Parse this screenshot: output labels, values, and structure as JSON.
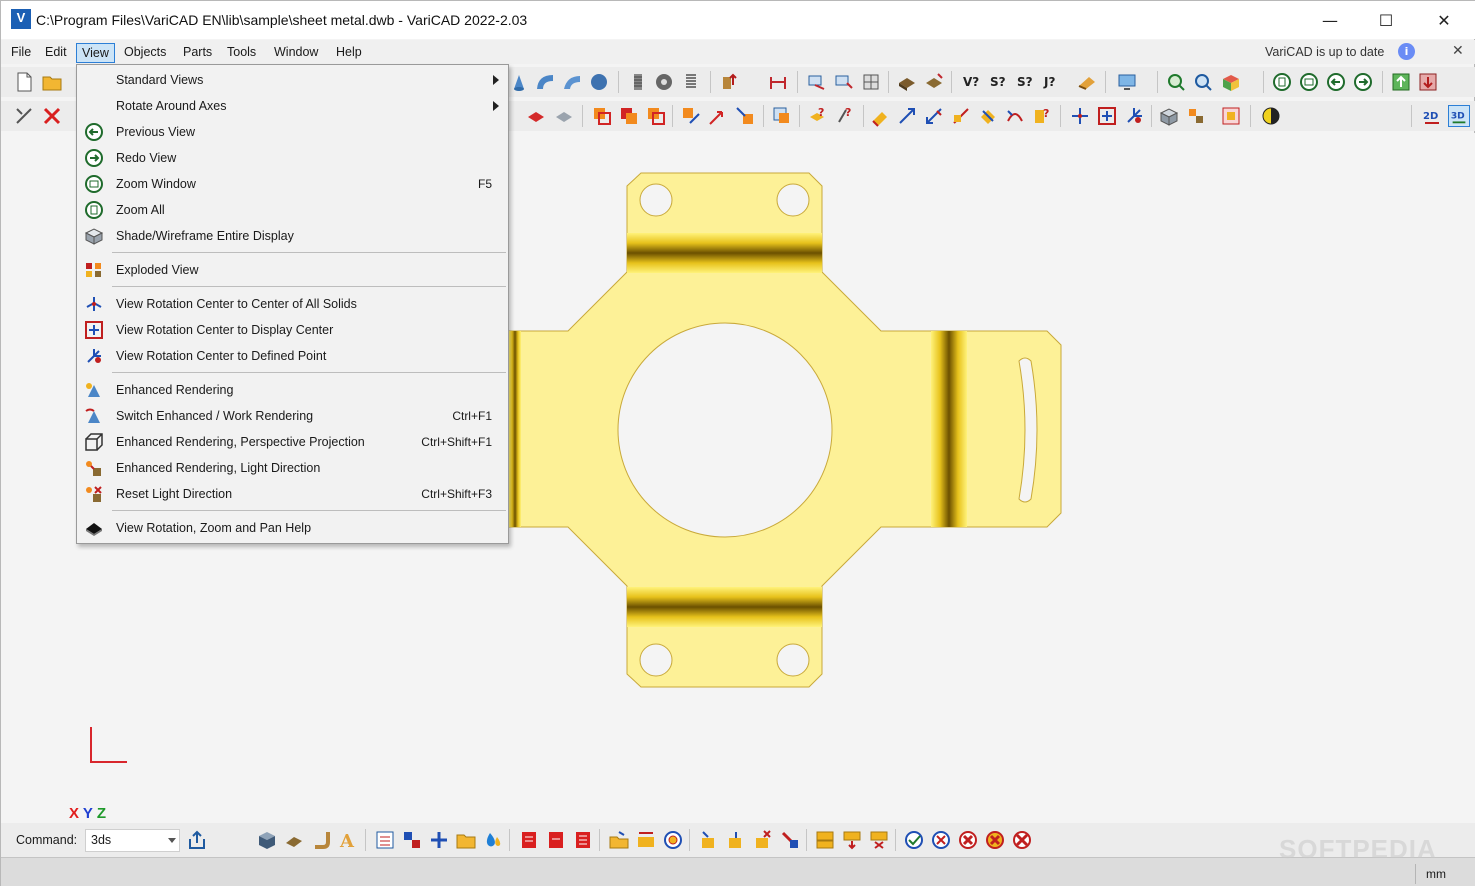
{
  "window": {
    "title": "C:\\Program Files\\VariCAD EN\\lib\\sample\\sheet metal.dwb - VariCAD 2022-2.03",
    "logo": "V",
    "minimize_glyph": "—",
    "maximize_glyph": "☐",
    "close_glyph": "✕"
  },
  "menubar": {
    "items": [
      "File",
      "Edit",
      "View",
      "Objects",
      "Parts",
      "Tools",
      "Window",
      "Help"
    ],
    "active": "View",
    "status_note": "VariCAD is up to date",
    "info_glyph": "i",
    "close_glyph": "✕"
  },
  "view_menu": {
    "items": [
      {
        "label": "Standard Views",
        "shortcut": "",
        "submenu": true,
        "icon": "none"
      },
      {
        "label": "Rotate Around Axes",
        "shortcut": "",
        "submenu": true,
        "icon": "none"
      },
      {
        "label": "Previous View",
        "shortcut": "",
        "icon": "previous-view-icon"
      },
      {
        "label": "Redo View",
        "shortcut": "",
        "icon": "redo-view-icon"
      },
      {
        "label": "Zoom Window",
        "shortcut": "F5",
        "icon": "zoom-window-icon"
      },
      {
        "label": "Zoom All",
        "shortcut": "",
        "icon": "zoom-all-icon"
      },
      {
        "label": "Shade/Wireframe Entire Display",
        "shortcut": "",
        "icon": "shade-wireframe-icon"
      },
      {
        "label": "Exploded View",
        "shortcut": "",
        "icon": "exploded-view-icon"
      },
      {
        "label": "View Rotation Center to Center of All Solids",
        "shortcut": "",
        "icon": "rotation-center-solids-icon"
      },
      {
        "label": "View Rotation Center to Display Center",
        "shortcut": "",
        "icon": "rotation-center-display-icon"
      },
      {
        "label": "View Rotation Center to Defined Point",
        "shortcut": "",
        "icon": "rotation-center-point-icon"
      },
      {
        "label": "Enhanced Rendering",
        "shortcut": "",
        "icon": "enhanced-rendering-icon"
      },
      {
        "label": "Switch Enhanced / Work Rendering",
        "shortcut": "Ctrl+F1",
        "icon": "switch-rendering-icon"
      },
      {
        "label": "Enhanced Rendering, Perspective Projection",
        "shortcut": "Ctrl+Shift+F1",
        "icon": "perspective-projection-icon"
      },
      {
        "label": "Enhanced Rendering, Light Direction",
        "shortcut": "",
        "icon": "light-direction-icon"
      },
      {
        "label": "Reset Light Direction",
        "shortcut": "Ctrl+Shift+F3",
        "icon": "reset-light-icon"
      },
      {
        "label": "View Rotation, Zoom and Pan Help",
        "shortcut": "",
        "icon": "help-book-icon"
      }
    ]
  },
  "axes": {
    "x": "X",
    "y": "Y",
    "z": "Z"
  },
  "command": {
    "label": "Command:",
    "value": "3ds"
  },
  "status": {
    "units": "mm"
  },
  "watermark": "SOFTPEDIA",
  "colors": {
    "accent": "#2c7fd6",
    "part_fill": "#fdf197",
    "part_stroke": "#c9a93a",
    "bend_dark": "#7a5e00",
    "bend_light": "#fff27a",
    "axis": "#d8262c"
  }
}
